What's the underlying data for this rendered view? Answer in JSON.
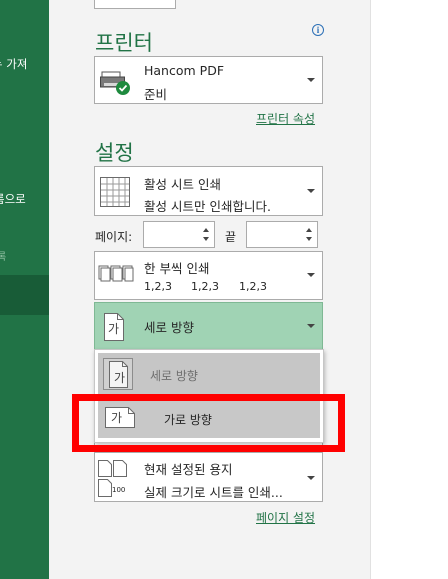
{
  "sidebar": {
    "snippet_1": "뉴 가져",
    "snippet_2": "름으로",
    "snippet_3": "록"
  },
  "printer": {
    "heading": "프린터",
    "name": "Hancom PDF",
    "status": "준비",
    "properties_link": "프린터 속성",
    "info_icon_glyph": "i"
  },
  "settings": {
    "heading": "설정",
    "print_what": {
      "title": "활성 시트 인쇄",
      "subtitle": "활성 시트만 인쇄합니다."
    },
    "pages": {
      "label": "페이지:",
      "from_value": "",
      "to_label": "끝",
      "to_value": ""
    },
    "collation": {
      "title": "한 부씩 인쇄",
      "order": [
        "1,2,3",
        "1,2,3",
        "1,2,3"
      ]
    },
    "orientation": {
      "selected": "세로 방향",
      "icon_glyph": "가",
      "options": [
        {
          "label": "세로 방향",
          "icon_glyph": "가"
        },
        {
          "label": "가로 방향",
          "icon_glyph": "가"
        }
      ]
    },
    "hidden_row_text": "... ... ..... ... ... .. ... ...",
    "paper": {
      "title": "현재 설정된 용지",
      "subtitle": "실제 크기로 시트를 인쇄...",
      "icon_label": "100"
    },
    "page_setup_link": "페이지 설정"
  },
  "colors": {
    "excel_green": "#217346",
    "selected_bg": "#a0d3b4",
    "highlight_red": "#ff0000"
  }
}
